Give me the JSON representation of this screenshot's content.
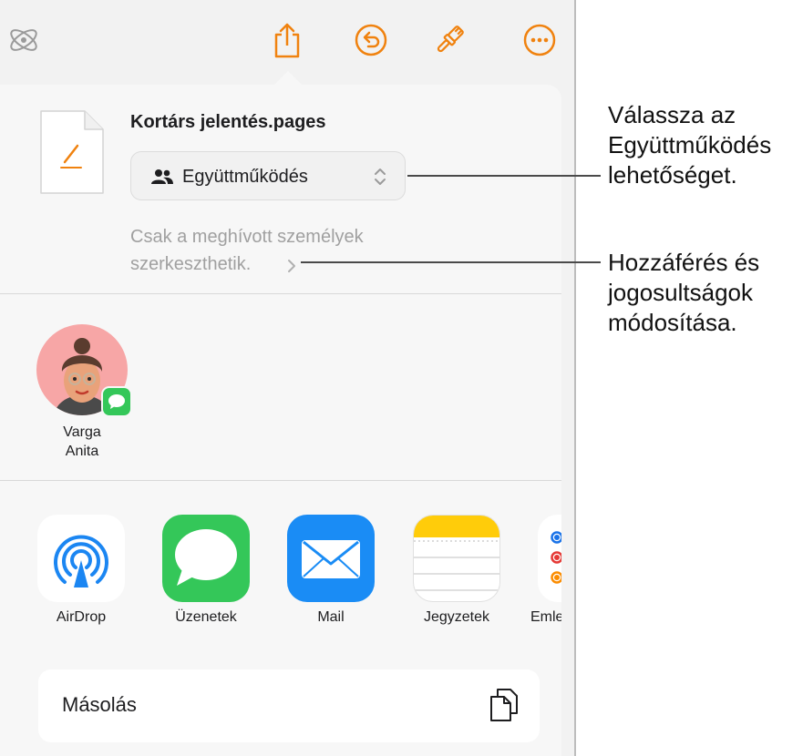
{
  "toolbar": {
    "left_icon": "magic-wand-icon",
    "buttons": [
      "share-icon",
      "undo-icon",
      "paintbrush-icon",
      "more-icon"
    ],
    "accent_color": "#f0820f"
  },
  "share_sheet": {
    "file_name": "Kortárs jelentés.pages",
    "collaboration_mode": "Együttműködés",
    "access_note": "Csak a meghívott személyek szerkeszthetik.",
    "contact": {
      "first": "Varga",
      "last": "Anita"
    },
    "apps": [
      {
        "id": "airdrop",
        "label": "AirDrop",
        "icon": "airdrop-icon"
      },
      {
        "id": "messages",
        "label": "Üzenetek",
        "icon": "messages-icon"
      },
      {
        "id": "mail",
        "label": "Mail",
        "icon": "mail-icon"
      },
      {
        "id": "notes",
        "label": "Jegyzetek",
        "icon": "notes-icon"
      },
      {
        "id": "reminders",
        "label": "Emle",
        "icon": "reminders-icon"
      }
    ],
    "copy_label": "Másolás"
  },
  "callouts": {
    "collab_line1": "Válassza az",
    "collab_line2": "Együttműködés",
    "collab_line3": "lehetőséget.",
    "access_line1": "Hozzáférés és",
    "access_line2": "jogosultságok",
    "access_line3": "módosítása."
  }
}
